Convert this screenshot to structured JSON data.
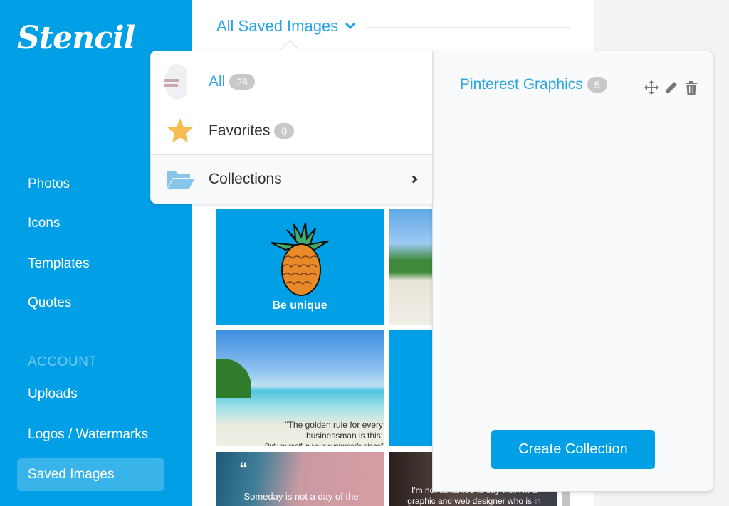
{
  "app": {
    "logo": "Stencil"
  },
  "sidebar": {
    "items": [
      {
        "label": "Photos"
      },
      {
        "label": "Icons"
      },
      {
        "label": "Templates"
      },
      {
        "label": "Quotes"
      }
    ],
    "section_label": "ACCOUNT",
    "account_items": [
      {
        "label": "Uploads"
      },
      {
        "label": "Logos / Watermarks"
      },
      {
        "label": "Saved Images",
        "active": true
      }
    ]
  },
  "header": {
    "title": "All Saved Images"
  },
  "dropdown": {
    "items": [
      {
        "label": "All",
        "count": "28",
        "icon": "image-thumbnail",
        "active": true
      },
      {
        "label": "Favorites",
        "count": "0",
        "icon": "star-icon"
      },
      {
        "label": "Collections",
        "icon": "folder-open-icon",
        "has_submenu": true
      }
    ]
  },
  "collections": {
    "items": [
      {
        "name": "Pinterest Graphics",
        "count": "5",
        "actions": [
          "move-icon",
          "pencil-icon",
          "trash-icon"
        ]
      }
    ],
    "create_button": "Create Collection"
  },
  "grid": {
    "tiles": [
      {
        "type": "pineapple",
        "caption": "Be unique",
        "bg": "#019fe6"
      },
      {
        "type": "beach"
      },
      {
        "type": "beach-quote",
        "quote_lines": [
          "\"The golden rule for every",
          "businessman is this:",
          "Put yourself in your customer's place\""
        ]
      },
      {
        "type": "solid",
        "bg": "#019fe6"
      },
      {
        "type": "paint-quote",
        "quote_lines": [
          "Someday is not a day of the"
        ]
      },
      {
        "type": "photo-quote",
        "quote_lines": [
          "I'm not ashamed to say that I'm a",
          "graphic and web designer who is in"
        ]
      }
    ]
  },
  "colors": {
    "brand": "#019fe6",
    "accent_text": "#2aa6e6",
    "badge": "#c8c8c8",
    "star": "#f5bd4f",
    "folder": "#86c6ea"
  }
}
